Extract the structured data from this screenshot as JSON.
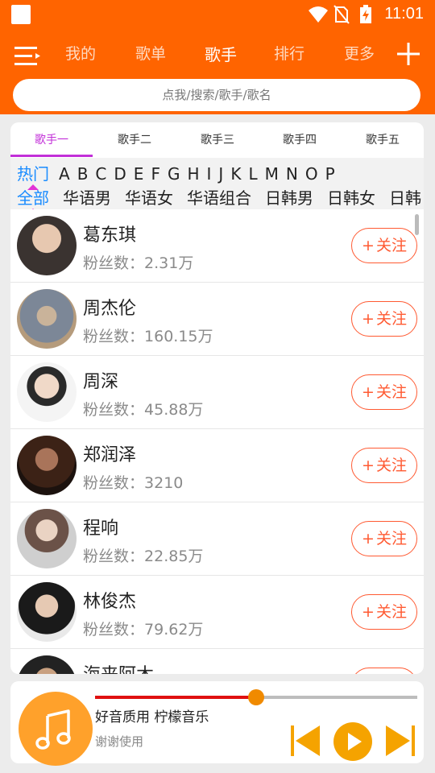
{
  "status": {
    "time": "11:01"
  },
  "header": {
    "tabs": [
      {
        "label": "我的"
      },
      {
        "label": "歌单"
      },
      {
        "label": "歌手"
      },
      {
        "label": "排行"
      },
      {
        "label": "更多"
      }
    ],
    "active_tab": "歌手",
    "search_placeholder": "点我/搜索/歌手/歌名"
  },
  "subtabs": [
    "歌手一",
    "歌手二",
    "歌手三",
    "歌手四",
    "歌手五"
  ],
  "active_subtab": "歌手一",
  "letter_filter": [
    "热门",
    "A",
    "B",
    "C",
    "D",
    "E",
    "F",
    "G",
    "H",
    "I",
    "J",
    "K",
    "L",
    "M",
    "N",
    "O",
    "P"
  ],
  "category_filter": [
    "全部",
    "华语男",
    "华语女",
    "华语组合",
    "日韩男",
    "日韩女",
    "日韩"
  ],
  "fans_prefix": "粉丝数：",
  "follow_label": "关注",
  "artists": [
    {
      "name": "葛东琪",
      "fans": "2.31万"
    },
    {
      "name": "周杰伦",
      "fans": "160.15万"
    },
    {
      "name": "周深",
      "fans": "45.88万"
    },
    {
      "name": "郑润泽",
      "fans": "3210"
    },
    {
      "name": "程响",
      "fans": "22.85万"
    },
    {
      "name": "林俊杰",
      "fans": "79.62万"
    },
    {
      "name": "海来阿木",
      "fans": ""
    }
  ],
  "player": {
    "title": "好音质用 柠檬音乐",
    "subtitle": "谢谢使用",
    "progress": 0.5
  },
  "colors": {
    "brand": "#ff6400",
    "accent_purple": "#c22fd8",
    "follow": "#ff5a32",
    "player_orange": "#f5a300"
  }
}
